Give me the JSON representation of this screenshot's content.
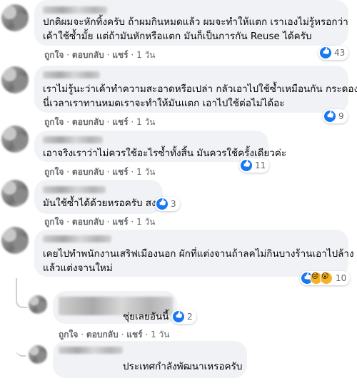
{
  "actions": {
    "like": "ถูกใจ",
    "reply": "ตอบกลับ",
    "share": "แชร์",
    "time": "1 วัน",
    "sep": "·"
  },
  "comments": [
    {
      "lines": [
        "ปกติผมจะหักทิ้งครับ ถ้าผมกินหมดแล้ว ผมจะทำให้แตก เราเองไม่รู้หรอกว่า",
        "เค้าใช้ซ้ำมั้ย แต่ถ้ามันหักหรือแตก มันก็เป็นการกัน Reuse ได้ครับ"
      ],
      "reactions": "43"
    },
    {
      "lines": [
        "เราไม่รู้นะว่าเค้าทำความสะอาดหรือเปล่า กลัวเอาไปใช้ซ้ำเหมือนกัน กระดองปู",
        "นี่เวลาเราทานหมดเราจะทำให้มันแตก เอาไปใช้ต่อไม่ได้อะ"
      ],
      "reactions": "9"
    },
    {
      "lines": [
        "เอาจริงเราว่าไม่ควรใช้อะไรซ้ำทั้งสิ้น มันควรใช้ครั้งเดียวค่ะ"
      ],
      "reactions": "11"
    },
    {
      "lines": [
        "มันใช้ซ้ำได้ด้วยหรอครับ สงสัย"
      ],
      "reactions": "3"
    },
    {
      "lines": [
        "เคยไปทำพนักงานเสริฟเมืองนอก ผักที่แต่งจานถ้าลคไม่กินบางร้านเอาไปล้าง",
        "แล้วแต่งจานใหม่"
      ],
      "reactions": "10"
    },
    {
      "lines": [
        "ชุ่ยเลยอันนี้"
      ],
      "reactions": "2"
    },
    {
      "lines": [
        "ประเทศกำลังพัฒนาเหรอครับ"
      ],
      "reactions": ""
    }
  ]
}
